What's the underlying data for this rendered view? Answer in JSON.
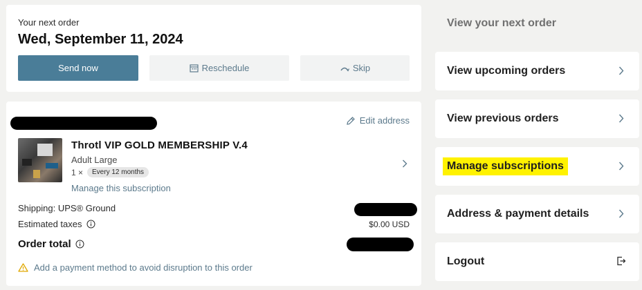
{
  "next_order": {
    "label": "Your next order",
    "date": "Wed, September 11, 2024",
    "send_now": "Send now",
    "reschedule": "Reschedule",
    "skip": "Skip"
  },
  "order": {
    "edit_address": "Edit address",
    "product_title": "Throtl VIP GOLD MEMBERSHIP V.4",
    "variant": "Adult Large",
    "quantity": "1 ×",
    "frequency": "Every 12 months",
    "manage_subscription": "Manage this subscription",
    "shipping_label": "Shipping: UPS® Ground",
    "taxes_label": "Estimated taxes",
    "taxes_value": "$0.00 USD",
    "total_label": "Order total",
    "warning": "Add a payment method to avoid disruption to this order"
  },
  "nav": {
    "next": "View your next order",
    "upcoming": "View upcoming orders",
    "previous": "View previous orders",
    "manage": "Manage subscriptions",
    "address": "Address & payment details",
    "logout": "Logout"
  },
  "colors": {
    "accent": "#4a7d98",
    "link": "#5c7a8c",
    "highlight": "#fff200",
    "warning_icon": "#e0a800"
  }
}
